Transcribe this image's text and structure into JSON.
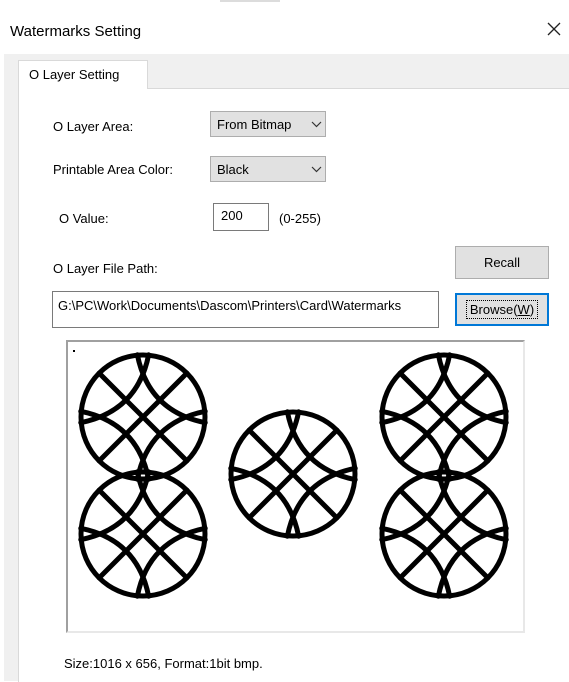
{
  "window": {
    "title": "Watermarks Setting"
  },
  "tabs": [
    {
      "label": "O Layer Setting"
    }
  ],
  "form": {
    "area_label": "O Layer Area:",
    "area_value": "From Bitmap",
    "color_label": "Printable Area Color:",
    "color_value": "Black",
    "ovalue_label": "O Value:",
    "ovalue_value": "200",
    "ovalue_range": "(0-255)",
    "path_label": "O Layer File Path:",
    "recall_label": "Recall",
    "path_value": "G:\\PC\\Work\\Documents\\Dascom\\Printers\\Card\\Watermarks",
    "browse_label": "Browse(",
    "browse_accel": "W",
    "browse_suffix": ")"
  },
  "preview": {
    "size_info": "Size:1016 x 656, Format:1bit bmp.",
    "symbol": "globe-icon",
    "ink_color": "#000000"
  },
  "colors": {
    "focus_border": "#0078d7",
    "panel": "#ffffff",
    "dialog_bg": "#f0f0f0",
    "button_face": "#e1e1e1"
  },
  "icons": {
    "close": "close-icon",
    "dropdown": "chevron-down-icon"
  }
}
